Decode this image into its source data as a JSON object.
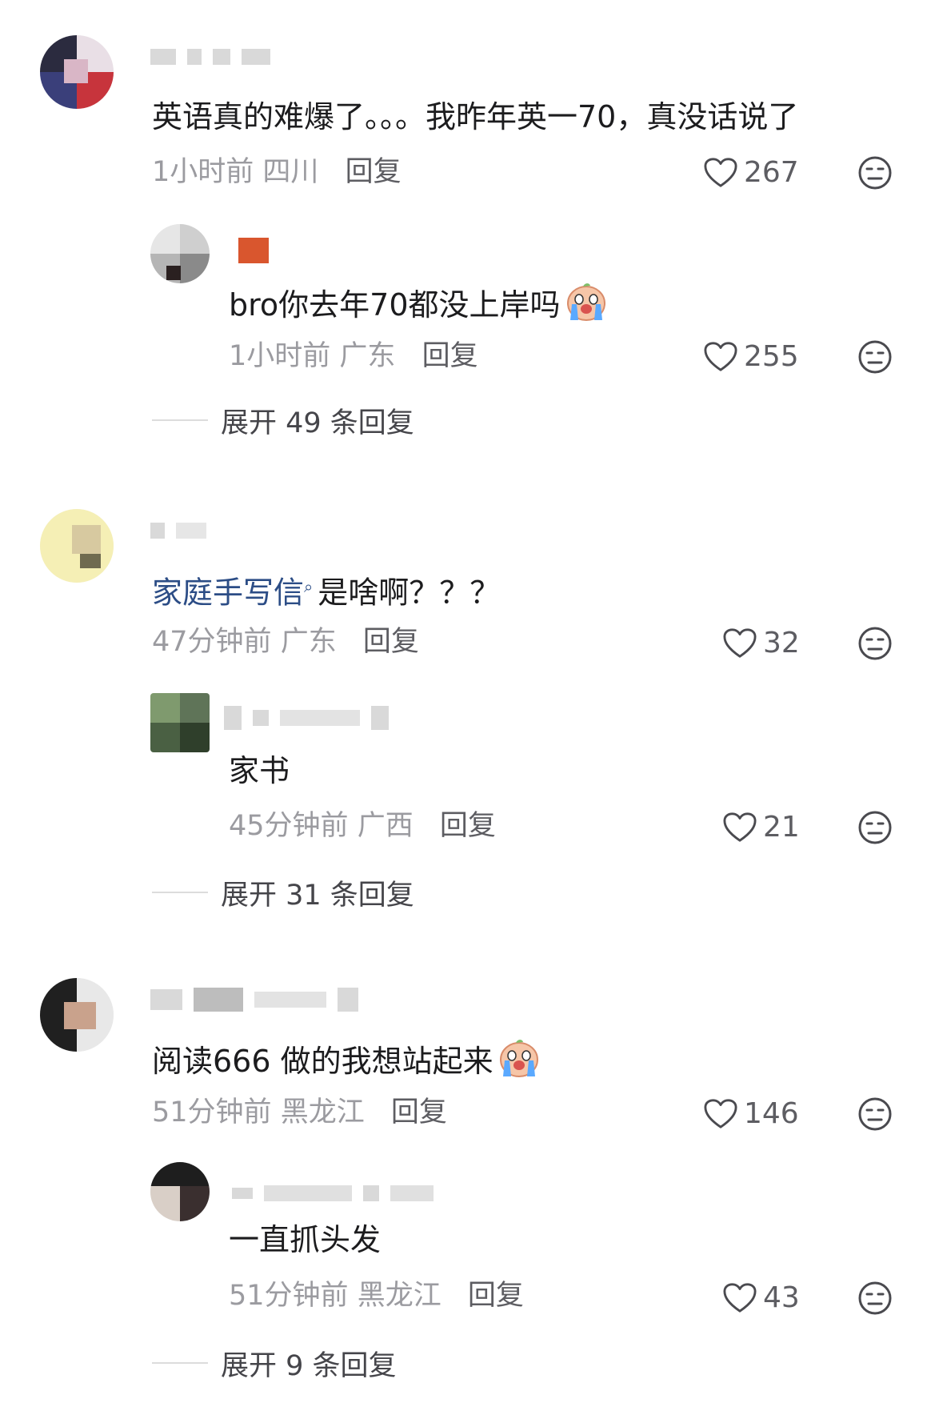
{
  "colors": {
    "background": "#ffffff",
    "text": "#1c1c1e",
    "meta_text": "#9b9ba0",
    "action_text": "#5d5d62",
    "topic_link": "#2c4d86"
  },
  "comments": [
    {
      "text": "英语真的难爆了。。。我昨年英一70，真没话说了",
      "time": "1小时前",
      "location": "四川",
      "reply_label": "回复",
      "likes": "267",
      "replies": [
        {
          "text": "bro你去年70都没上岸吗",
          "emoji": "crying-emoji",
          "time": "1小时前",
          "location": "广东",
          "reply_label": "回复",
          "likes": "255"
        }
      ],
      "expand_label": "展开 49 条回复"
    },
    {
      "topic": "家庭手写信",
      "text": "是啥啊？？？",
      "time": "47分钟前",
      "location": "广东",
      "reply_label": "回复",
      "likes": "32",
      "replies": [
        {
          "text": "家书",
          "time": "45分钟前",
          "location": "广西",
          "reply_label": "回复",
          "likes": "21"
        }
      ],
      "expand_label": "展开 31 条回复"
    },
    {
      "text": "阅读666 做的我想站起来",
      "emoji": "crying-emoji",
      "time": "51分钟前",
      "location": "黑龙江",
      "reply_label": "回复",
      "likes": "146",
      "replies": [
        {
          "text": "一直抓头发",
          "time": "51分钟前",
          "location": "黑龙江",
          "reply_label": "回复",
          "likes": "43"
        }
      ],
      "expand_label": "展开 9 条回复"
    }
  ],
  "icons": {
    "like": "heart-outline-icon",
    "dislike": "unamused-face-icon",
    "search_suffix": "search-icon"
  }
}
